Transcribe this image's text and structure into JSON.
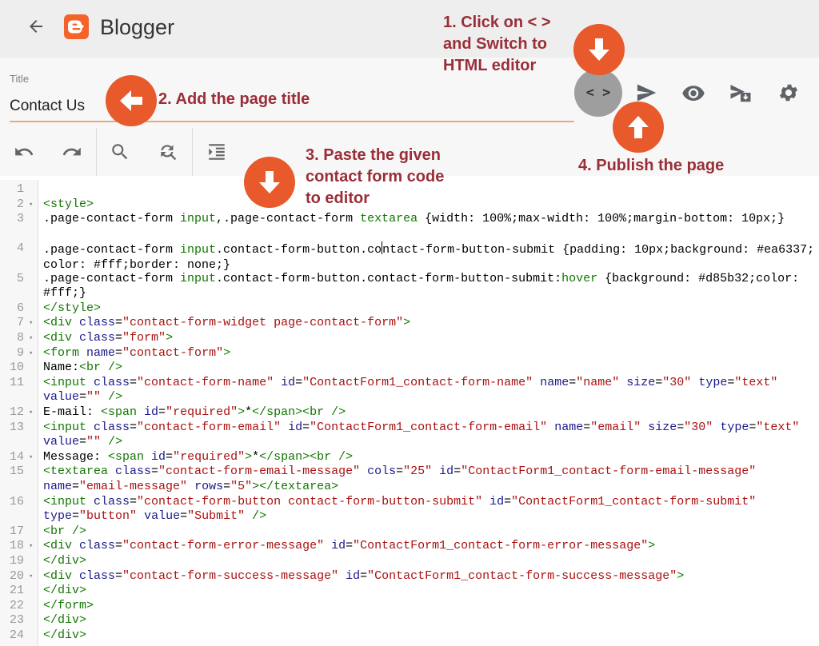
{
  "header": {
    "app_name": "Blogger"
  },
  "editor": {
    "title_label": "Title",
    "title_value": "Contact Us",
    "html_toggle_label": "< >"
  },
  "annotations": {
    "step1": "1. Click on < >\nand Switch to\nHTML editor",
    "step2": "2. Add the page title",
    "step3": "3. Paste the given\ncontact form code\nto editor",
    "step4": "4. Publish the page"
  },
  "colors": {
    "annotation_circle": "#e8592b",
    "annotation_text": "#9a2e38",
    "brand": "#f4642a",
    "code_tag": "#117700",
    "code_attr": "#1a1a8c",
    "code_string": "#aa1111"
  },
  "code_lines": [
    {
      "n": "1",
      "fold": false,
      "tokens": []
    },
    {
      "n": "2",
      "fold": true,
      "tokens": [
        [
          "t",
          "<style>"
        ]
      ]
    },
    {
      "n": "3",
      "fold": false,
      "tokens": [
        [
          "p",
          ".page-contact-form "
        ],
        [
          "t",
          "input"
        ],
        [
          "p",
          ",.page-contact-form "
        ],
        [
          "t",
          "textarea"
        ],
        [
          "p",
          " {width: 100%;max-width: 100%;margin-bottom: 10px;}"
        ]
      ]
    },
    {
      "n": "4",
      "fold": false,
      "tokens": [
        [
          "p",
          ".page-contact-form "
        ],
        [
          "t",
          "input"
        ],
        [
          "p",
          ".contact-form-button.co"
        ],
        [
          "c",
          ""
        ],
        [
          "p",
          "ntact-form-button-submit {padding: 10px;background: #ea6337; color: #fff;border: none;}"
        ]
      ]
    },
    {
      "n": "5",
      "fold": false,
      "tokens": [
        [
          "p",
          ".page-contact-form "
        ],
        [
          "t",
          "input"
        ],
        [
          "p",
          ".contact-form-button.contact-form-button-submit:"
        ],
        [
          "t",
          "hover"
        ],
        [
          "p",
          " {background: #d85b32;color: #fff;}"
        ]
      ]
    },
    {
      "n": "6",
      "fold": false,
      "tokens": [
        [
          "t",
          "</style>"
        ]
      ]
    },
    {
      "n": "7",
      "fold": true,
      "tokens": [
        [
          "t",
          "<div "
        ],
        [
          "a",
          "class"
        ],
        [
          "p",
          "="
        ],
        [
          "s",
          "\"contact-form-widget page-contact-form\""
        ],
        [
          "t",
          ">"
        ]
      ]
    },
    {
      "n": "8",
      "fold": true,
      "tokens": [
        [
          "t",
          "<div "
        ],
        [
          "a",
          "class"
        ],
        [
          "p",
          "="
        ],
        [
          "s",
          "\"form\""
        ],
        [
          "t",
          ">"
        ]
      ]
    },
    {
      "n": "9",
      "fold": true,
      "tokens": [
        [
          "t",
          "<form "
        ],
        [
          "a",
          "name"
        ],
        [
          "p",
          "="
        ],
        [
          "s",
          "\"contact-form\""
        ],
        [
          "t",
          ">"
        ]
      ]
    },
    {
      "n": "10",
      "fold": false,
      "tokens": [
        [
          "p",
          "Name:"
        ],
        [
          "t",
          "<br />"
        ]
      ]
    },
    {
      "n": "11",
      "fold": false,
      "tokens": [
        [
          "t",
          "<input "
        ],
        [
          "a",
          "class"
        ],
        [
          "p",
          "="
        ],
        [
          "s",
          "\"contact-form-name\""
        ],
        [
          "p",
          " "
        ],
        [
          "a",
          "id"
        ],
        [
          "p",
          "="
        ],
        [
          "s",
          "\"ContactForm1_contact-form-name\""
        ],
        [
          "p",
          " "
        ],
        [
          "a",
          "name"
        ],
        [
          "p",
          "="
        ],
        [
          "s",
          "\"name\""
        ],
        [
          "p",
          " "
        ],
        [
          "a",
          "size"
        ],
        [
          "p",
          "="
        ],
        [
          "s",
          "\"30\""
        ],
        [
          "p",
          " "
        ],
        [
          "a",
          "type"
        ],
        [
          "p",
          "="
        ],
        [
          "s",
          "\"text\""
        ],
        [
          "p",
          " "
        ],
        [
          "a",
          "value"
        ],
        [
          "p",
          "="
        ],
        [
          "s",
          "\"\""
        ],
        [
          "p",
          " "
        ],
        [
          "t",
          "/>"
        ]
      ]
    },
    {
      "n": "12",
      "fold": true,
      "tokens": [
        [
          "p",
          "E-mail: "
        ],
        [
          "t",
          "<span "
        ],
        [
          "a",
          "id"
        ],
        [
          "p",
          "="
        ],
        [
          "s",
          "\"required\""
        ],
        [
          "t",
          ">"
        ],
        [
          "p",
          "*"
        ],
        [
          "t",
          "</span><br />"
        ]
      ]
    },
    {
      "n": "13",
      "fold": false,
      "tokens": [
        [
          "t",
          "<input "
        ],
        [
          "a",
          "class"
        ],
        [
          "p",
          "="
        ],
        [
          "s",
          "\"contact-form-email\""
        ],
        [
          "p",
          " "
        ],
        [
          "a",
          "id"
        ],
        [
          "p",
          "="
        ],
        [
          "s",
          "\"ContactForm1_contact-form-email\""
        ],
        [
          "p",
          " "
        ],
        [
          "a",
          "name"
        ],
        [
          "p",
          "="
        ],
        [
          "s",
          "\"email\""
        ],
        [
          "p",
          " "
        ],
        [
          "a",
          "size"
        ],
        [
          "p",
          "="
        ],
        [
          "s",
          "\"30\""
        ],
        [
          "p",
          " "
        ],
        [
          "a",
          "type"
        ],
        [
          "p",
          "="
        ],
        [
          "s",
          "\"text\""
        ],
        [
          "p",
          " "
        ],
        [
          "a",
          "value"
        ],
        [
          "p",
          "="
        ],
        [
          "s",
          "\"\""
        ],
        [
          "p",
          " "
        ],
        [
          "t",
          "/>"
        ]
      ]
    },
    {
      "n": "14",
      "fold": true,
      "tokens": [
        [
          "p",
          "Message: "
        ],
        [
          "t",
          "<span "
        ],
        [
          "a",
          "id"
        ],
        [
          "p",
          "="
        ],
        [
          "s",
          "\"required\""
        ],
        [
          "t",
          ">"
        ],
        [
          "p",
          "*"
        ],
        [
          "t",
          "</span><br />"
        ]
      ]
    },
    {
      "n": "15",
      "fold": false,
      "tokens": [
        [
          "t",
          "<textarea "
        ],
        [
          "a",
          "class"
        ],
        [
          "p",
          "="
        ],
        [
          "s",
          "\"contact-form-email-message\""
        ],
        [
          "p",
          " "
        ],
        [
          "a",
          "cols"
        ],
        [
          "p",
          "="
        ],
        [
          "s",
          "\"25\""
        ],
        [
          "p",
          " "
        ],
        [
          "a",
          "id"
        ],
        [
          "p",
          "="
        ],
        [
          "s",
          "\"ContactForm1_contact-form-email-message\""
        ],
        [
          "p",
          " "
        ],
        [
          "a",
          "name"
        ],
        [
          "p",
          "="
        ],
        [
          "s",
          "\"email-message\""
        ],
        [
          "p",
          " "
        ],
        [
          "a",
          "rows"
        ],
        [
          "p",
          "="
        ],
        [
          "s",
          "\"5\""
        ],
        [
          "t",
          "></textarea>"
        ]
      ]
    },
    {
      "n": "16",
      "fold": false,
      "tokens": [
        [
          "t",
          "<input "
        ],
        [
          "a",
          "class"
        ],
        [
          "p",
          "="
        ],
        [
          "s",
          "\"contact-form-button contact-form-button-submit\""
        ],
        [
          "p",
          " "
        ],
        [
          "a",
          "id"
        ],
        [
          "p",
          "="
        ],
        [
          "s",
          "\"ContactForm1_contact-form-submit\""
        ],
        [
          "p",
          " "
        ],
        [
          "a",
          "type"
        ],
        [
          "p",
          "="
        ],
        [
          "s",
          "\"button\""
        ],
        [
          "p",
          " "
        ],
        [
          "a",
          "value"
        ],
        [
          "p",
          "="
        ],
        [
          "s",
          "\"Submit\""
        ],
        [
          "p",
          " "
        ],
        [
          "t",
          "/>"
        ]
      ]
    },
    {
      "n": "17",
      "fold": false,
      "tokens": [
        [
          "t",
          "<br />"
        ]
      ]
    },
    {
      "n": "18",
      "fold": true,
      "tokens": [
        [
          "t",
          "<div "
        ],
        [
          "a",
          "class"
        ],
        [
          "p",
          "="
        ],
        [
          "s",
          "\"contact-form-error-message\""
        ],
        [
          "p",
          " "
        ],
        [
          "a",
          "id"
        ],
        [
          "p",
          "="
        ],
        [
          "s",
          "\"ContactForm1_contact-form-error-message\""
        ],
        [
          "t",
          ">"
        ]
      ]
    },
    {
      "n": "19",
      "fold": false,
      "tokens": [
        [
          "t",
          "</div>"
        ]
      ]
    },
    {
      "n": "20",
      "fold": true,
      "tokens": [
        [
          "t",
          "<div "
        ],
        [
          "a",
          "class"
        ],
        [
          "p",
          "="
        ],
        [
          "s",
          "\"contact-form-success-message\""
        ],
        [
          "p",
          " "
        ],
        [
          "a",
          "id"
        ],
        [
          "p",
          "="
        ],
        [
          "s",
          "\"ContactForm1_contact-form-success-message\""
        ],
        [
          "t",
          ">"
        ]
      ]
    },
    {
      "n": "21",
      "fold": false,
      "tokens": [
        [
          "t",
          "</div>"
        ]
      ]
    },
    {
      "n": "22",
      "fold": false,
      "tokens": [
        [
          "t",
          "</form>"
        ]
      ]
    },
    {
      "n": "23",
      "fold": false,
      "tokens": [
        [
          "t",
          "</div>"
        ]
      ]
    },
    {
      "n": "24",
      "fold": false,
      "tokens": [
        [
          "t",
          "</div>"
        ]
      ]
    }
  ]
}
